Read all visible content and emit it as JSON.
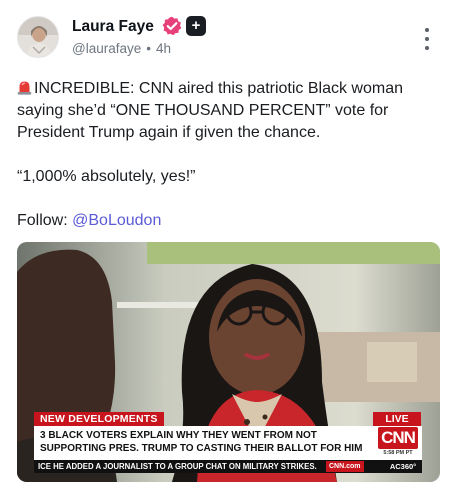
{
  "author": {
    "name": "Laura Faye",
    "handle": "@laurafaye",
    "separator": "•",
    "time": "4h",
    "plus_badge": "+",
    "verified_color": "#e8407a"
  },
  "post": {
    "line1_prefix_icon": "siren-emoji",
    "paragraph1": "INCREDIBLE: CNN aired this patriotic Black woman saying she’d “ONE THOUSAND PERCENT” vote for President Trump again if given the chance.",
    "paragraph2": "“1,000% absolutely, yes!”",
    "follow_label": "Follow:",
    "follow_mention": "@BoLoudon",
    "mention_color": "#5b5bd6"
  },
  "video": {
    "banner_tag": "NEW DEVELOPMENTS",
    "live_tag": "LIVE",
    "headline_line1": "3 BLACK VOTERS EXPLAIN WHY THEY WENT FROM NOT",
    "headline_line2": "SUPPORTING PRES. TRUMP TO CASTING THEIR BALLOT FOR HIM",
    "network_logo": "CNN",
    "timestamp": "5:58 PM PT",
    "ticker": "ICE HE ADDED A JOURNALIST TO A GROUP CHAT ON MILITARY STRIKES.",
    "ticker_site": "CNN.com",
    "show_name": "AC360°",
    "brand_red": "#c8141c"
  }
}
